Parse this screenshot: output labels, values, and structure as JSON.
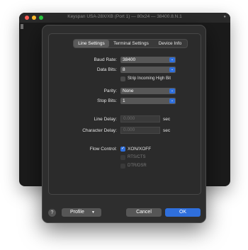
{
  "terminal": {
    "title": "Keyspan USA-28X/XB (Port 1) — 80x24 — 38400.8.N.1",
    "lock_icon": "lock-icon"
  },
  "tabs": [
    {
      "label": "Line Settings",
      "selected": true
    },
    {
      "label": "Terminal Settings",
      "selected": false
    },
    {
      "label": "Device Info",
      "selected": false
    }
  ],
  "form": {
    "baud_rate_label": "Baud Rate:",
    "baud_rate_value": "38400",
    "data_bits_label": "Data Bits:",
    "data_bits_value": "8",
    "strip_high_bit_label": "Strip Incoming High Bit",
    "strip_high_bit_checked": false,
    "parity_label": "Parity:",
    "parity_value": "None",
    "stop_bits_label": "Stop Bits:",
    "stop_bits_value": "1",
    "line_delay_label": "Line Delay:",
    "line_delay_value": "0.000",
    "line_delay_unit": "sec",
    "char_delay_label": "Character Delay:",
    "char_delay_value": "0.000",
    "char_delay_unit": "sec",
    "flow_control_label": "Flow Control:",
    "flow_options": [
      {
        "label": "XON/XOFF",
        "checked": true,
        "enabled": true
      },
      {
        "label": "RTS/CTS",
        "checked": false,
        "enabled": false
      },
      {
        "label": "DTR/DSR",
        "checked": false,
        "enabled": false
      }
    ]
  },
  "footer": {
    "help_label": "?",
    "profile_label": "Profile",
    "cancel_label": "Cancel",
    "ok_label": "OK"
  },
  "colors": {
    "accent": "#2f6fdc",
    "sheet_bg": "#2e2e2e"
  }
}
